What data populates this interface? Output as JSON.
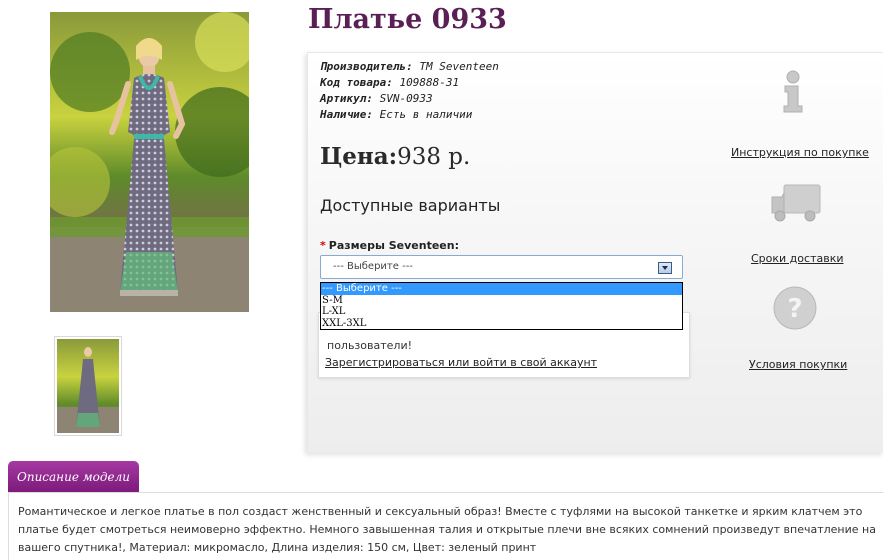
{
  "product": {
    "title": "Платье 0933",
    "specs": [
      {
        "label": "Производитель:",
        "value": "TM Seventeen"
      },
      {
        "label": "Код товара:",
        "value": "109888-31"
      },
      {
        "label": "Артикул:",
        "value": "SVN-0933"
      },
      {
        "label": "Наличие:",
        "value": "Есть в наличии"
      }
    ],
    "price_label": "Цена:",
    "price_value": "938 р."
  },
  "options": {
    "heading": "Доступные варианты",
    "size_label": "Размеры Seventeen:",
    "required_mark": "*",
    "select_value": "--- Выберите ---",
    "dropdown_options": [
      "--- Выберите ---",
      "S-M",
      "L-XL",
      "XXL-3XL"
    ]
  },
  "notice": {
    "partial_text": "пользователи!",
    "login_link": "Зарегистрироваться или войти в свой аккаунт"
  },
  "side_links": [
    {
      "icon": "info-icon",
      "label": "Инструкция по покупке"
    },
    {
      "icon": "truck-icon",
      "label": "Сроки доставки"
    },
    {
      "icon": "question-icon",
      "label": "Условия покупки"
    }
  ],
  "tabs": [
    {
      "label": "Описание модели"
    }
  ],
  "description": {
    "text": "Романтическое и легкое платье в пол создаст женственный и сексуальный образ! Вместе с туфлями на высокой танкетке и ярким клатчем это платье будет смотреться неимоверно эффектно. Немного завышенная талия и открытые плечи вне всяких сомнений произведут впечатление на вашего спутника!, Материал: микромасло, Длина изделия: 150 см, Цвет: зеленый принт"
  },
  "colors": {
    "accent": "#7c1a7a",
    "title": "#5a1f55",
    "select_highlight": "#3399ff"
  }
}
